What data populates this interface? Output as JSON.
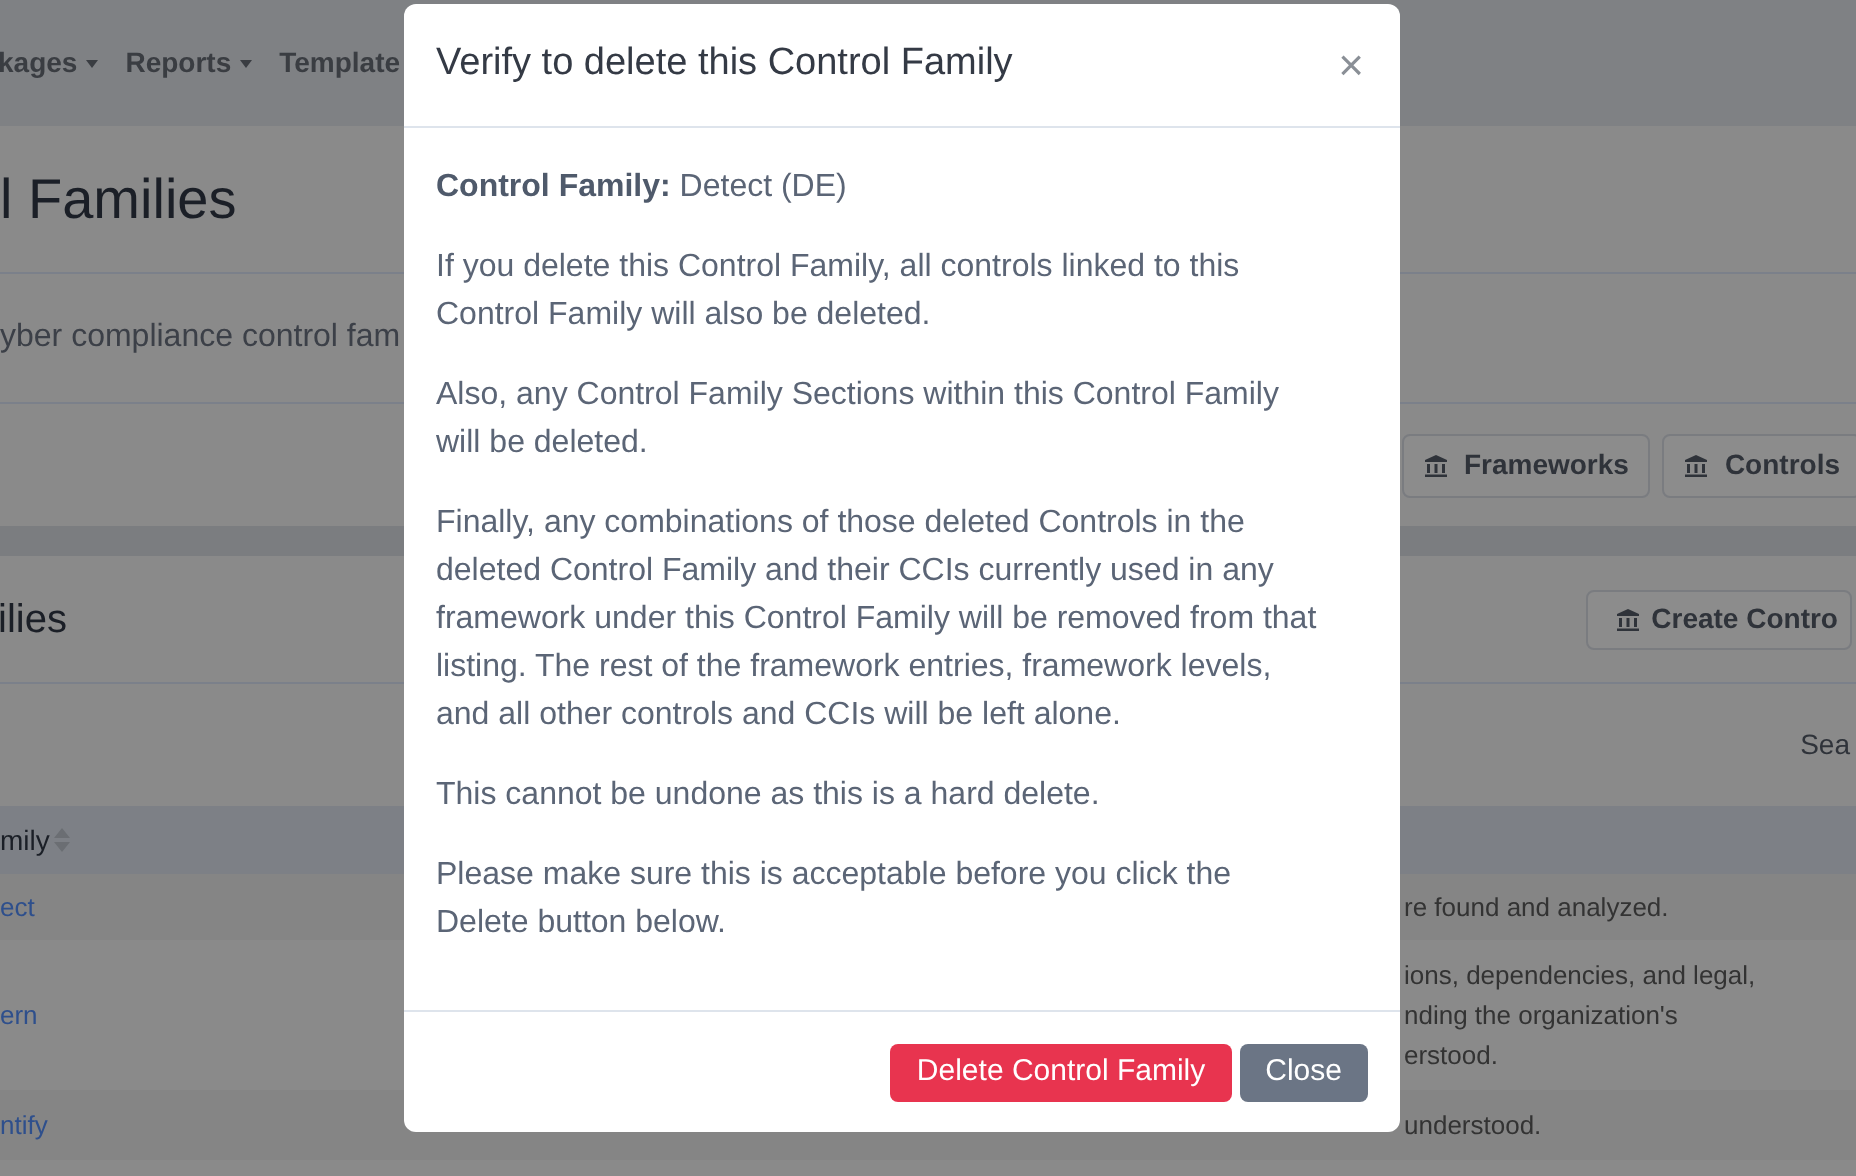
{
  "navbar": {
    "items": [
      {
        "label": "kages",
        "dropdown": true
      },
      {
        "label": "Reports",
        "dropdown": true
      },
      {
        "label": "Template",
        "dropdown": false
      }
    ]
  },
  "page_header": {
    "title": "l Families",
    "description": "yber compliance control fam",
    "buttons": [
      "Frameworks",
      "Controls"
    ]
  },
  "list_card": {
    "title": "ilies",
    "create_button": "Create Contro",
    "search_label": "Sea",
    "table": {
      "columns": [
        "mily"
      ],
      "rows": [
        {
          "name": "ect",
          "description": [
            "re found and analyzed."
          ]
        },
        {
          "name": "ern",
          "description": [
            "ions, dependencies, and legal,",
            "nding the organization's",
            "erstood."
          ]
        },
        {
          "name": "ntify",
          "description": [
            "understood."
          ]
        }
      ]
    }
  },
  "modal": {
    "title": "Verify to delete this Control Family",
    "close_icon": "×",
    "paragraphs": [
      "**Control Family:** Detect (DE)",
      "If you delete this Control Family, all controls linked to this Control Family will also be deleted.",
      "Also, any Control Family Sections within this Control Family will be deleted.",
      "Finally, any combinations of those deleted Controls in the deleted Control Family and their CCIs currently used in any framework under this Control Family will be removed from that listing. The rest of the framework entries, framework levels, and all other controls and CCIs will be left alone.",
      "This cannot be undone as this is a hard delete.",
      "Please make sure this is acceptable before you click the Delete button below."
    ],
    "buttons": [
      {
        "label": "Delete Control Family",
        "kind": "danger"
      },
      {
        "label": "Close",
        "kind": "secondary"
      }
    ]
  }
}
